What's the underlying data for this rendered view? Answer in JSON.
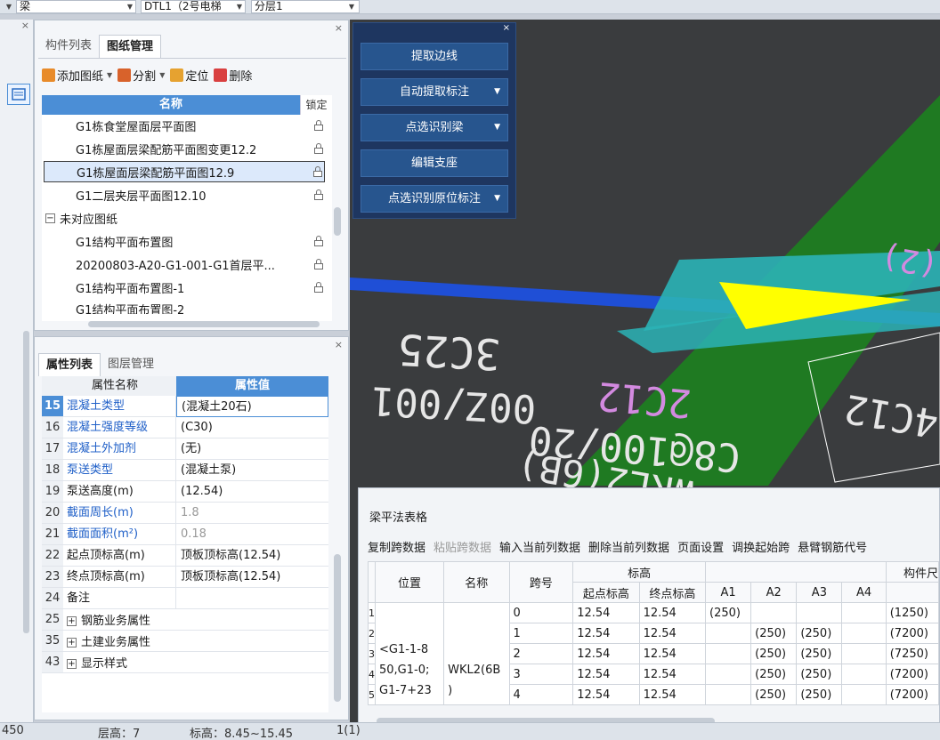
{
  "topbar": {
    "type_value": "梁",
    "member_value": "DTL1（2号电梯",
    "layer_value": "分层1"
  },
  "drawing_panel": {
    "tabs": [
      "构件列表",
      "图纸管理"
    ],
    "toolbar": {
      "add": "添加图纸",
      "split": "分割",
      "locate": "定位",
      "delete": "删除"
    },
    "headers": {
      "name": "名称",
      "lock": "锁定"
    },
    "rows": [
      {
        "label": "G1栋食堂屋面层平面图"
      },
      {
        "label": "G1栋屋面层梁配筋平面图变更12.2"
      },
      {
        "label": "G1栋屋面层梁配筋平面图12.9"
      },
      {
        "label": "G1二层夹层平面图12.10"
      },
      {
        "label": "未对应图纸"
      },
      {
        "label": "G1结构平面布置图"
      },
      {
        "label": "20200803-A20-G1-001-G1首层平..."
      },
      {
        "label": "G1结构平面布置图-1"
      },
      {
        "label": "G1结构平面布置图-2"
      }
    ]
  },
  "property_panel": {
    "tabs": [
      "属性列表",
      "图层管理"
    ],
    "headers": {
      "name": "属性名称",
      "value": "属性值"
    },
    "rows": [
      {
        "num": "15",
        "name": "混凝土类型",
        "value": "(混凝土20石)"
      },
      {
        "num": "16",
        "name": "混凝土强度等级",
        "value": "(C30)"
      },
      {
        "num": "17",
        "name": "混凝土外加剂",
        "value": "(无)"
      },
      {
        "num": "18",
        "name": "泵送类型",
        "value": "(混凝土泵)"
      },
      {
        "num": "19",
        "name": "泵送高度(m)",
        "value": "(12.54)"
      },
      {
        "num": "20",
        "name": "截面周长(m)",
        "value": "1.8"
      },
      {
        "num": "21",
        "name": "截面面积(m²)",
        "value": "0.18"
      },
      {
        "num": "22",
        "name": "起点顶标高(m)",
        "value": "顶板顶标高(12.54)"
      },
      {
        "num": "23",
        "name": "终点顶标高(m)",
        "value": "顶板顶标高(12.54)"
      },
      {
        "num": "24",
        "name": "备注",
        "value": ""
      },
      {
        "num": "25",
        "name": "钢筋业务属性",
        "value": ""
      },
      {
        "num": "35",
        "name": "土建业务属性",
        "value": ""
      },
      {
        "num": "43",
        "name": "显示样式",
        "value": ""
      }
    ]
  },
  "float_panel": {
    "buttons": [
      "提取边线",
      "自动提取标注",
      "点选识别梁",
      "编辑支座",
      "点选识别原位标注"
    ]
  },
  "viewport_text": {
    "t1": "3C25",
    "t2": "00Z/001",
    "t3": "C8@100/20",
    "t4": "2C12",
    "t5": "WKL2(6B)",
    "t6": "4C12",
    "t7": "(2)"
  },
  "beam_table": {
    "title": "梁平法表格",
    "toolbar": [
      "复制跨数据",
      "粘贴跨数据",
      "输入当前列数据",
      "删除当前列数据",
      "页面设置",
      "调换起始跨",
      "悬臂钢筋代号"
    ],
    "headers": {
      "position": "位置",
      "name": "名称",
      "span": "跨号",
      "elev": "标高",
      "start_elev": "起点标高",
      "end_elev": "终点标高",
      "a1": "A1",
      "a2": "A2",
      "a3": "A3",
      "a4": "A4",
      "member": "构件尺"
    },
    "position_value": "<G1-1-8 50,G1-0; G1-7+23",
    "name_value": "WKL2(6B )",
    "rows": [
      {
        "idx": "1",
        "span": "0",
        "start": "12.54",
        "end": "12.54",
        "a1": "(250)",
        "a2": "",
        "a3": "",
        "a4": "",
        "size": "(1250)"
      },
      {
        "idx": "2",
        "span": "1",
        "start": "12.54",
        "end": "12.54",
        "a1": "",
        "a2": "(250)",
        "a3": "(250)",
        "a4": "",
        "size": "(7200)"
      },
      {
        "idx": "3",
        "span": "2",
        "start": "12.54",
        "end": "12.54",
        "a1": "",
        "a2": "(250)",
        "a3": "(250)",
        "a4": "",
        "size": "(7250)"
      },
      {
        "idx": "4",
        "span": "3",
        "start": "12.54",
        "end": "12.54",
        "a1": "",
        "a2": "(250)",
        "a3": "(250)",
        "a4": "",
        "size": "(7200)"
      },
      {
        "idx": "5",
        "span": "4",
        "start": "12.54",
        "end": "12.54",
        "a1": "",
        "a2": "(250)",
        "a3": "(250)",
        "a4": "",
        "size": "(7200)"
      }
    ]
  },
  "statusbar": {
    "left": "450",
    "floor": "层高：7",
    "elevation": "标高：8.45~15.45",
    "count": "1(1)"
  },
  "colors": {
    "accent": "#4b8ed6",
    "float_bg": "#1e3660",
    "beam_green": "#1f7a22",
    "beam_blue": "#1f4fd6",
    "highlight_cyan": "#2bb3b6",
    "arrow_yellow": "#ffff00",
    "text_pink": "#d38ae0"
  }
}
